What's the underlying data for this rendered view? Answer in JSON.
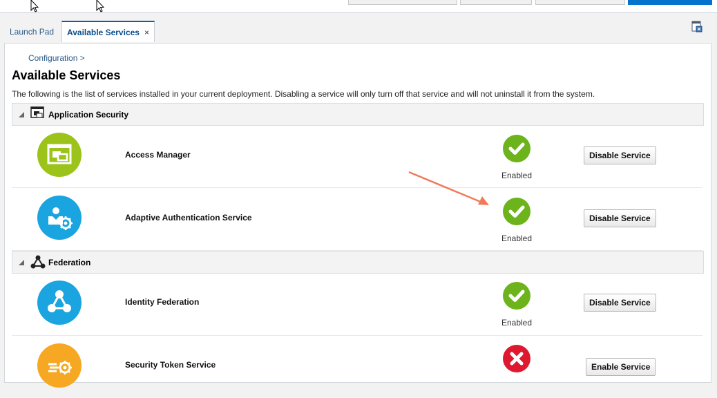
{
  "tabs": {
    "launch_pad": "Launch Pad",
    "available_services": "Available Services",
    "close_glyph": "×"
  },
  "breadcrumb": "Configuration >",
  "page": {
    "title": "Available Services",
    "description": "The following is the list of services installed in your current deployment. Disabling a service will only turn off that service and will not uninstall it from the system."
  },
  "sections": [
    {
      "title": "Application Security",
      "icon": "application-security-icon"
    },
    {
      "title": "Federation",
      "icon": "federation-icon"
    }
  ],
  "services": [
    {
      "name": "Access Manager",
      "status": "Enabled",
      "state": "enabled",
      "action": "Disable Service",
      "icon": "access-manager-icon",
      "icon_color": "#9bc31a"
    },
    {
      "name": "Adaptive Authentication Service",
      "status": "Enabled",
      "state": "enabled",
      "action": "Disable Service",
      "icon": "adaptive-authentication-icon",
      "icon_color": "#1aa4e0"
    },
    {
      "name": "Identity Federation",
      "status": "Enabled",
      "state": "enabled",
      "action": "Disable Service",
      "icon": "identity-federation-icon",
      "icon_color": "#1aa4e0"
    },
    {
      "name": "Security Token Service",
      "status": "",
      "state": "disabled",
      "action": "Enable Service",
      "icon": "security-token-icon",
      "icon_color": "#f7a823"
    }
  ],
  "colors": {
    "enabled": "#6cb31c",
    "disabled": "#e0182f",
    "link": "#2b5a8a",
    "annotation_arrow": "#f07b5a"
  }
}
